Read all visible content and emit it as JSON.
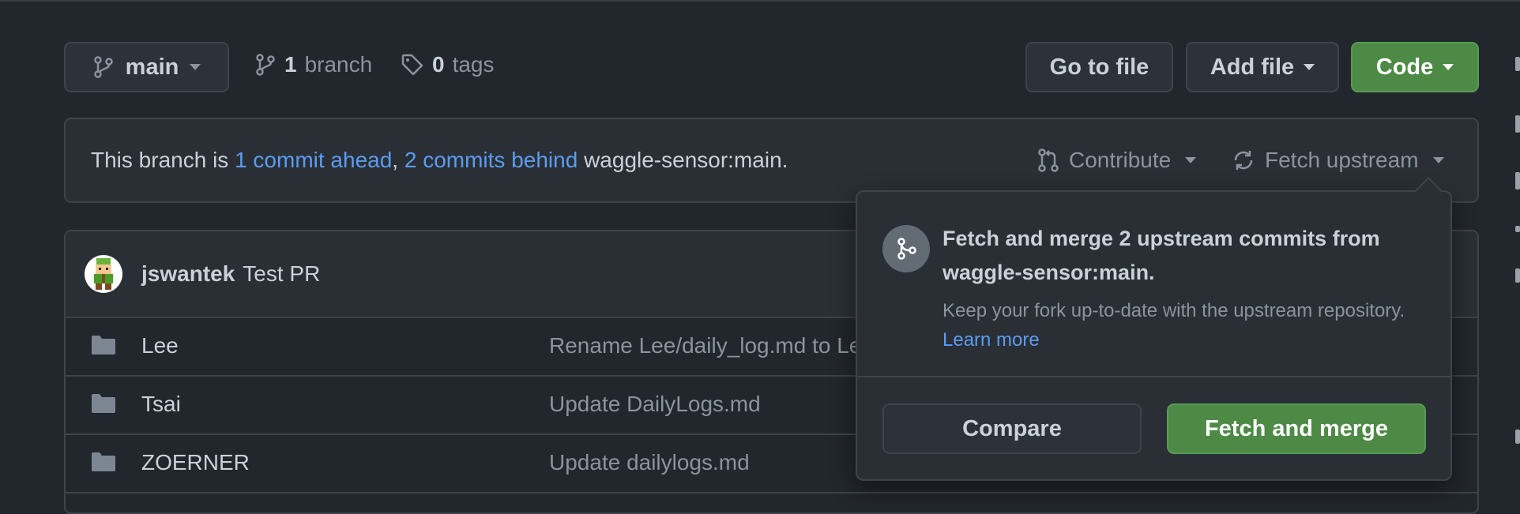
{
  "branch_select": {
    "label": "main"
  },
  "branches": {
    "count": "1",
    "label": "branch"
  },
  "tags": {
    "count": "0",
    "label": "tags"
  },
  "actions": {
    "go_to_file": "Go to file",
    "add_file": "Add file",
    "code": "Code"
  },
  "banner": {
    "prefix": "This branch is ",
    "ahead": "1 commit ahead",
    "separator": ", ",
    "behind": "2 commits behind",
    "upstream": " waggle-sensor:main.",
    "contribute": "Contribute",
    "fetch_upstream": "Fetch upstream"
  },
  "latest_commit": {
    "author": "jswantek",
    "message": "Test PR"
  },
  "files": [
    {
      "name": "Lee",
      "message": "Rename Lee/daily_log.md to Le"
    },
    {
      "name": "Tsai",
      "message": "Update DailyLogs.md"
    },
    {
      "name": "ZOERNER",
      "message": "Update dailylogs.md"
    }
  ],
  "popover": {
    "title": "Fetch and merge 2 upstream commits from waggle-sensor:main.",
    "description": "Keep your fork up-to-date with the upstream repository. ",
    "learn_more": "Learn more",
    "compare": "Compare",
    "fetch_and_merge": "Fetch and merge"
  },
  "colors": {
    "background": "#22262d",
    "accent_link": "#5b9cf0",
    "primary_green": "#4d8a45"
  }
}
